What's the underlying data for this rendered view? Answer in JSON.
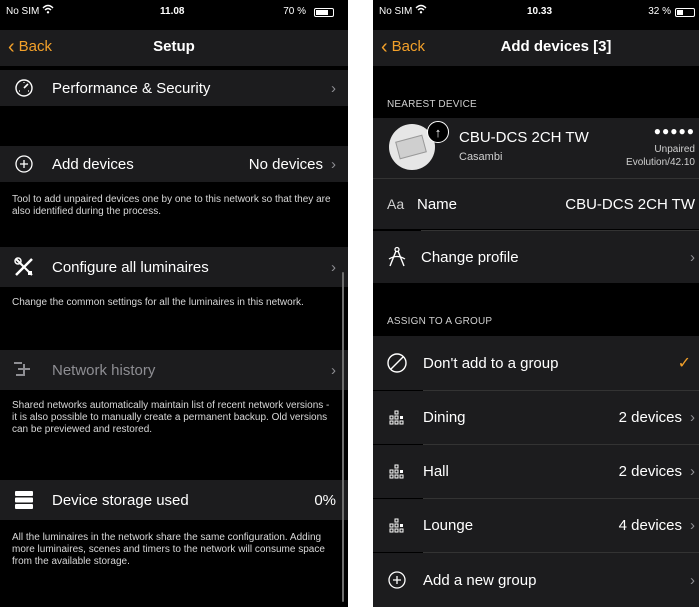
{
  "left": {
    "status": {
      "carrier": "No SIM",
      "time": "11.08",
      "battery": "70 %"
    },
    "nav": {
      "back": "Back",
      "title": "Setup"
    },
    "rows": [
      {
        "label": "Performance & Security",
        "icon": "gauge-icon"
      },
      {
        "label": "Add devices",
        "value": "No devices",
        "icon": "plus-circle-icon"
      },
      {
        "label": "Configure all luminaires",
        "icon": "tools-icon"
      },
      {
        "label": "Network history",
        "icon": "history-icon"
      },
      {
        "label": "Device storage used",
        "value": "0%",
        "icon": "storage-icon"
      }
    ],
    "descriptions": {
      "add_devices": "Tool to add unpaired devices one by one to this network so that they are also identified during the process.",
      "configure": "Change the common settings for all the luminaires in this network.",
      "history": "Shared networks automatically maintain list of recent network versions - it is also possible to manually create a permanent backup. Old versions can be previewed and restored.",
      "storage": "All the luminaires in the network share the same configuration. Adding more luminaires, scenes and timers to the network will consume space from the available storage."
    }
  },
  "right": {
    "status": {
      "carrier": "No SIM",
      "time": "10.33",
      "battery": "32 %"
    },
    "nav": {
      "back": "Back",
      "title": "Add devices [3]"
    },
    "nearest_header": "NEAREST DEVICE",
    "device": {
      "name": "CBU-DCS 2CH TW",
      "vendor": "Casambi",
      "signal": "●●●●●",
      "status": "Unpaired",
      "firmware": "Evolution/42.10"
    },
    "name_row": {
      "prefix": "Aa",
      "label": "Name",
      "value": "CBU-DCS 2CH TW"
    },
    "profile_row": {
      "label": "Change profile"
    },
    "assign_header": "ASSIGN TO A GROUP",
    "groups": [
      {
        "label": "Don't add to a group",
        "value": "",
        "check": "✓"
      },
      {
        "label": "Dining",
        "value": "2 devices"
      },
      {
        "label": "Hall",
        "value": "2 devices"
      },
      {
        "label": "Lounge",
        "value": "4 devices"
      },
      {
        "label": "Add a new group",
        "value": ""
      }
    ]
  },
  "colors": {
    "accent": "#f2a02a",
    "background": "#000000",
    "cell": "#1c1c1e"
  }
}
